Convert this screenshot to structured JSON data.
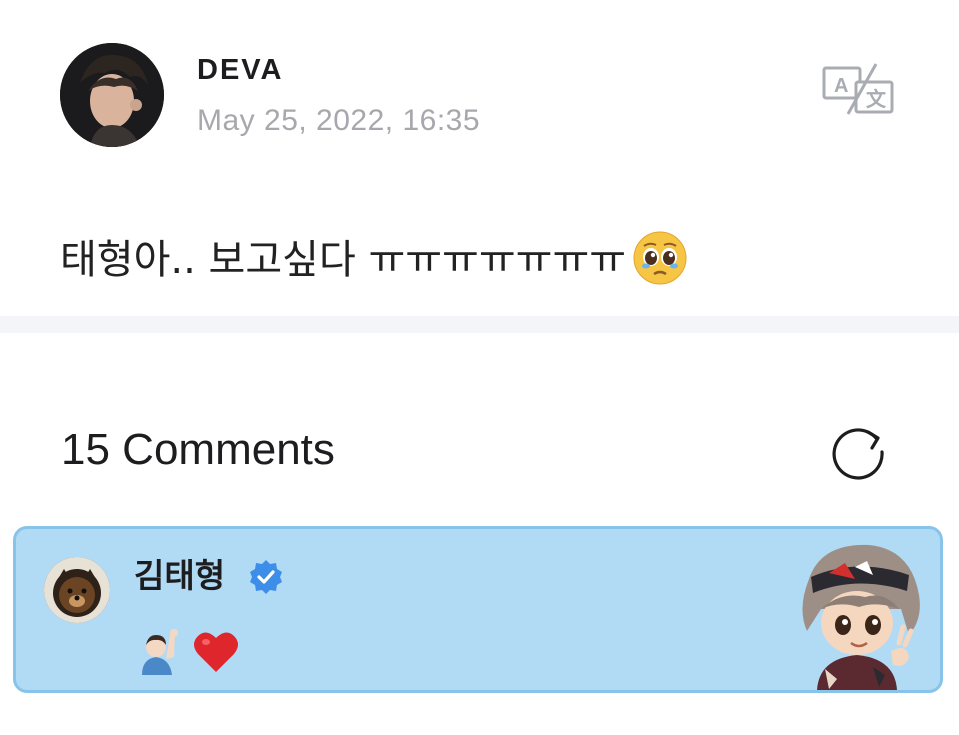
{
  "post": {
    "author": "DEVA",
    "date": "May 25, 2022, 16:35",
    "text": "태형아.. 보고싶다 ㅠㅠㅠㅠㅠㅠㅠ",
    "trailing_emoji": "pleading-face",
    "translate_icon": "translate-icon"
  },
  "comments": {
    "count_label": "15 Comments",
    "refresh_icon": "refresh-icon",
    "items": [
      {
        "author": "김태형",
        "verified": true,
        "emojis": [
          "person-raising-hand",
          "red-heart"
        ],
        "sticker": "character-sticker",
        "highlight_color": "#b1dbf5"
      }
    ]
  },
  "colors": {
    "date_gray": "#a7a7ad",
    "divider": "#f4f5f8",
    "card_bg": "#b1dbf5",
    "card_border": "#88c4ea",
    "verified_blue": "#3d8ee8"
  }
}
